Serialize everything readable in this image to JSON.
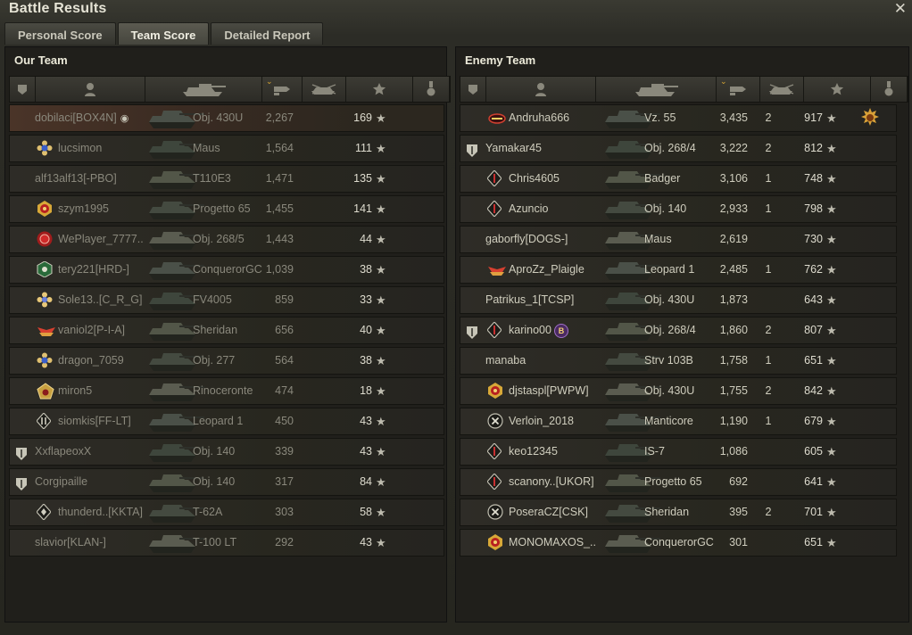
{
  "window": {
    "title": "Battle Results",
    "close": "✕"
  },
  "tabs": [
    {
      "label": "Personal Score",
      "active": false
    },
    {
      "label": "Team Score",
      "active": true
    },
    {
      "label": "Detailed Report",
      "active": false
    }
  ],
  "colors": {
    "accent_sort": "#d9a531",
    "self_row": "#4a3428"
  },
  "our_team": {
    "title": "Our Team",
    "players": [
      {
        "name": "dobilaci[BOX4N]",
        "tank": "Obj. 430U",
        "damage": "2,267",
        "kills": "",
        "xp": "169",
        "rank": "none",
        "badge": "",
        "self": true,
        "dead": true
      },
      {
        "name": "lucsimon",
        "tank": "Maus",
        "damage": "1,564",
        "kills": "",
        "xp": "111",
        "rank": "flower-blue",
        "badge": "",
        "dead": true
      },
      {
        "name": "alf13alf13[-PBO]",
        "tank": "T110E3",
        "damage": "1,471",
        "kills": "",
        "xp": "135",
        "rank": "none",
        "badge": "",
        "dead": true
      },
      {
        "name": "szym1995",
        "tank": "Progetto 65",
        "damage": "1,455",
        "kills": "",
        "xp": "141",
        "rank": "gold-red",
        "badge": "",
        "dead": true
      },
      {
        "name": "WePlayer_7777..",
        "tank": "Obj. 268/5",
        "damage": "1,443",
        "kills": "",
        "xp": "44",
        "rank": "red-gear",
        "badge": "",
        "dead": true
      },
      {
        "name": "tery221[HRD-]",
        "tank": "ConquerorGC",
        "damage": "1,039",
        "kills": "",
        "xp": "38",
        "rank": "green-hex",
        "badge": "",
        "dead": true
      },
      {
        "name": "Sole13..[C_R_G]",
        "tank": "FV4005",
        "damage": "859",
        "kills": "",
        "xp": "33",
        "rank": "flower-gold",
        "badge": "",
        "dead": true
      },
      {
        "name": "vaniol2[P-I-A]",
        "tank": "Sheridan",
        "damage": "656",
        "kills": "",
        "xp": "40",
        "rank": "wings-red",
        "badge": "",
        "dead": true
      },
      {
        "name": "dragon_7059",
        "tank": "Obj. 277",
        "damage": "564",
        "kills": "",
        "xp": "38",
        "rank": "flower-blue",
        "badge": "",
        "dead": true
      },
      {
        "name": "miron5",
        "tank": "Rinoceronte",
        "damage": "474",
        "kills": "",
        "xp": "18",
        "rank": "pentagon-gold",
        "badge": "",
        "dead": true
      },
      {
        "name": "siomkis[FF-LT]",
        "tank": "Leopard 1",
        "damage": "450",
        "kills": "",
        "xp": "43",
        "rank": "diamond-2",
        "badge": "",
        "dead": true
      },
      {
        "name": "XxflapeoxX",
        "tank": "Obj. 140",
        "damage": "339",
        "kills": "",
        "xp": "43",
        "rank": "none",
        "badge": "shield",
        "dead": true
      },
      {
        "name": "Corgipaille",
        "tank": "Obj. 140",
        "damage": "317",
        "kills": "",
        "xp": "84",
        "rank": "none",
        "badge": "shield",
        "dead": true
      },
      {
        "name": "thunderd..[KKTA]",
        "tank": "T-62A",
        "damage": "303",
        "kills": "",
        "xp": "58",
        "rank": "diamond-4",
        "badge": "",
        "dead": true
      },
      {
        "name": "slavior[KLAN-]",
        "tank": "T-100 LT",
        "damage": "292",
        "kills": "",
        "xp": "43",
        "rank": "none",
        "badge": "",
        "dead": true
      }
    ]
  },
  "enemy_team": {
    "title": "Enemy Team",
    "players": [
      {
        "name": "Andruha666",
        "tank": "Vz. 55",
        "damage": "3,435",
        "kills": "2",
        "xp": "917",
        "rank": "wings-red2",
        "badge": "",
        "medal": true
      },
      {
        "name": "Yamakar45",
        "tank": "Obj. 268/4",
        "damage": "3,222",
        "kills": "2",
        "xp": "812",
        "rank": "none",
        "badge": "shield"
      },
      {
        "name": "Chris4605",
        "tank": "Badger",
        "damage": "3,106",
        "kills": "1",
        "xp": "748",
        "rank": "diamond-1",
        "badge": ""
      },
      {
        "name": "Azuncio",
        "tank": "Obj. 140",
        "damage": "2,933",
        "kills": "1",
        "xp": "798",
        "rank": "diamond-1",
        "badge": ""
      },
      {
        "name": "gaborfly[DOGS-]",
        "tank": "Maus",
        "damage": "2,619",
        "kills": "",
        "xp": "730",
        "rank": "none",
        "badge": ""
      },
      {
        "name": "AproZz_Plaigle",
        "tank": "Leopard 1",
        "damage": "2,485",
        "kills": "1",
        "xp": "762",
        "rank": "wings-red",
        "badge": ""
      },
      {
        "name": "Patrikus_1[TCSP]",
        "tank": "Obj. 430U",
        "damage": "1,873",
        "kills": "",
        "xp": "643",
        "rank": "none",
        "badge": ""
      },
      {
        "name": "karino00",
        "tank": "Obj. 268/4",
        "damage": "1,860",
        "kills": "2",
        "xp": "807",
        "rank": "diamond-1",
        "badge": "shield",
        "platoon": "B"
      },
      {
        "name": "manaba",
        "tank": "Strv 103B",
        "damage": "1,758",
        "kills": "1",
        "xp": "651",
        "rank": "none",
        "badge": ""
      },
      {
        "name": "djstaspl[PWPW]",
        "tank": "Obj. 430U",
        "damage": "1,755",
        "kills": "2",
        "xp": "842",
        "rank": "gold-red",
        "badge": ""
      },
      {
        "name": "Verloin_2018",
        "tank": "Manticore",
        "damage": "1,190",
        "kills": "1",
        "xp": "679",
        "rank": "x-circle",
        "badge": ""
      },
      {
        "name": "keo12345",
        "tank": "IS-7",
        "damage": "1,086",
        "kills": "",
        "xp": "605",
        "rank": "diamond-1",
        "badge": ""
      },
      {
        "name": "scanony..[UKOR]",
        "tank": "Progetto 65",
        "damage": "692",
        "kills": "",
        "xp": "641",
        "rank": "diamond-1",
        "badge": ""
      },
      {
        "name": "PoseraCZ[CSK]",
        "tank": "Sheridan",
        "damage": "395",
        "kills": "2",
        "xp": "701",
        "rank": "x-circle",
        "badge": ""
      },
      {
        "name": "MONOMAXOS_..",
        "tank": "ConquerorGC",
        "damage": "301",
        "kills": "",
        "xp": "651",
        "rank": "gold-red",
        "badge": ""
      }
    ]
  },
  "column_icons": [
    "badge-icon",
    "player-icon",
    "tank-icon",
    "damage-icon",
    "kills-icon",
    "xp-star-icon",
    "medal-icon"
  ]
}
